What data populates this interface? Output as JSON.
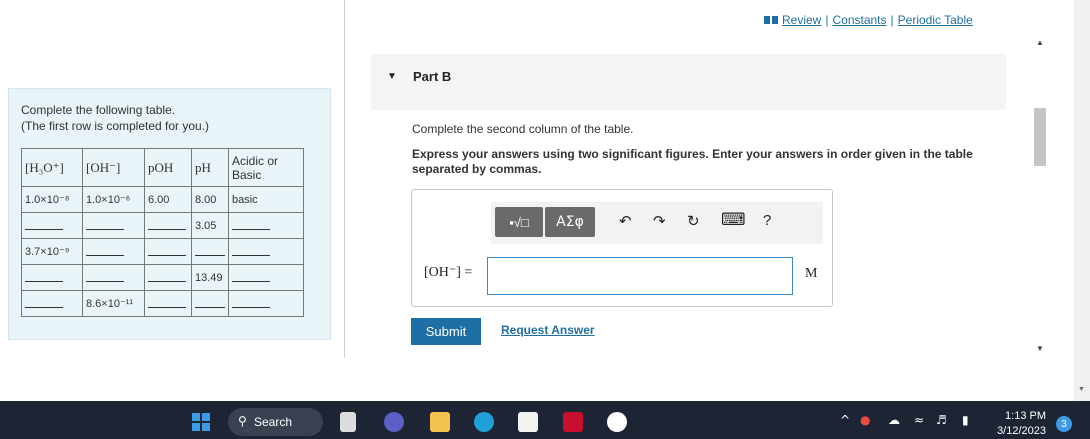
{
  "left": {
    "instruction_line1": "Complete the following table.",
    "instruction_line2": "(The first row is completed for you.)",
    "headers": {
      "h3o": "[H₃O⁺]",
      "oh": "[OH⁻]",
      "poh": "pOH",
      "ph": "pH",
      "acid_basic_1": "Acidic or",
      "acid_basic_2": "Basic"
    },
    "rows": [
      {
        "h3o": "1.0×10⁻⁸",
        "oh": "1.0×10⁻⁶",
        "poh": "6.00",
        "ph": "8.00",
        "ab": "basic"
      },
      {
        "h3o": "",
        "oh": "",
        "poh": "",
        "ph": "3.05",
        "ab": ""
      },
      {
        "h3o": "3.7×10⁻⁹",
        "oh": "",
        "poh": "",
        "ph": "",
        "ab": ""
      },
      {
        "h3o": "",
        "oh": "",
        "poh": "",
        "ph": "13.49",
        "ab": ""
      },
      {
        "h3o": "",
        "oh": "8.6×10⁻¹¹",
        "poh": "",
        "ph": "",
        "ab": ""
      }
    ]
  },
  "links": {
    "review": "Review",
    "sep": "|",
    "constants": "Constants",
    "periodic": "Periodic Table"
  },
  "part": {
    "arrow": "▼",
    "title": "Part B"
  },
  "question": {
    "line1": "Complete the second column of the table.",
    "line2": "Express your answers using two significant figures. Enter your answers in order given in the table separated by commas."
  },
  "toolbar": {
    "templates": "▪√□",
    "greek": "ΑΣφ",
    "undo": "↶",
    "redo": "↷",
    "reset": "↻",
    "keyboard": "⌨",
    "help": "?"
  },
  "answer": {
    "label": "[OH⁻] =",
    "value": "",
    "unit": "M"
  },
  "buttons": {
    "submit": "Submit",
    "request": "Request Answer"
  },
  "taskbar": {
    "search": "Search",
    "time": "1:13 PM",
    "date": "3/12/2023",
    "notifications": "3"
  }
}
